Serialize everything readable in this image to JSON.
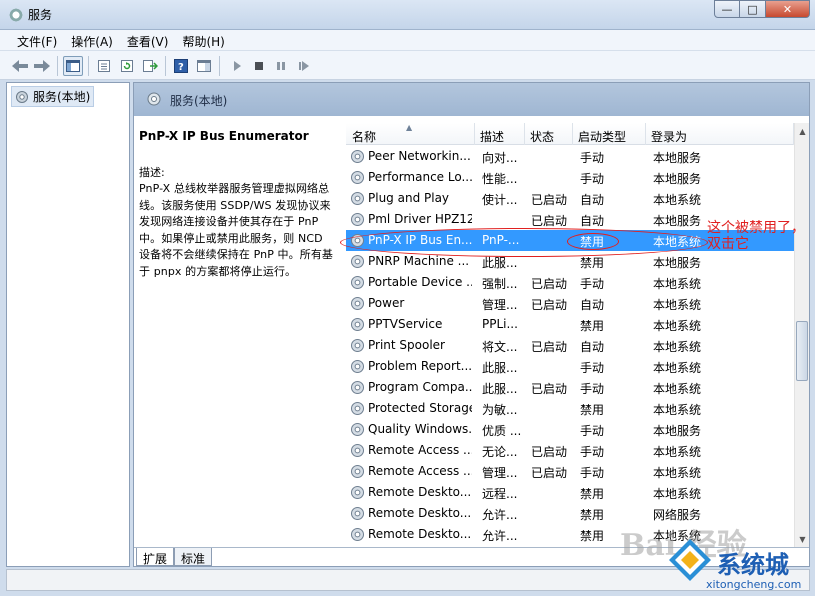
{
  "window": {
    "title": "服务",
    "controls": {
      "minimize": "—",
      "maximize": "□",
      "close": "✕"
    }
  },
  "menubar": [
    {
      "label": "文件(F)"
    },
    {
      "label": "操作(A)"
    },
    {
      "label": "查看(V)"
    },
    {
      "label": "帮助(H)"
    }
  ],
  "tree": {
    "item": "服务(本地)"
  },
  "pane_header": "服务(本地)",
  "description": {
    "title": "PnP-X IP Bus Enumerator",
    "label": "描述:",
    "body": "PnP-X 总线枚举器服务管理虚拟网络总线。该服务使用 SSDP/WS 发现协议来发现网络连接设备并使其存在于 PnP 中。如果停止或禁用此服务，则 NCD 设备将不会继续保持在 PnP 中。所有基于 pnpx 的方案都将停止运行。"
  },
  "columns": {
    "name": "名称",
    "desc": "描述",
    "status": "状态",
    "startup": "启动类型",
    "logon": "登录为"
  },
  "services": [
    {
      "name": "Peer Networkin...",
      "desc": "向对...",
      "status": "",
      "startup": "手动",
      "logon": "本地服务"
    },
    {
      "name": "Performance Lo...",
      "desc": "性能...",
      "status": "",
      "startup": "手动",
      "logon": "本地服务"
    },
    {
      "name": "Plug and Play",
      "desc": "使计...",
      "status": "已启动",
      "startup": "自动",
      "logon": "本地系统"
    },
    {
      "name": "Pml Driver HPZ12",
      "desc": "",
      "status": "已启动",
      "startup": "自动",
      "logon": "本地服务"
    },
    {
      "name": "PnP-X IP Bus En...",
      "desc": "PnP-...",
      "status": "",
      "startup": "禁用",
      "logon": "本地系统",
      "selected": true
    },
    {
      "name": "PNRP Machine ...",
      "desc": "此服...",
      "status": "",
      "startup": "禁用",
      "logon": "本地服务"
    },
    {
      "name": "Portable Device ...",
      "desc": "强制...",
      "status": "已启动",
      "startup": "手动",
      "logon": "本地系统"
    },
    {
      "name": "Power",
      "desc": "管理...",
      "status": "已启动",
      "startup": "自动",
      "logon": "本地系统"
    },
    {
      "name": "PPTVService",
      "desc": "PPLi...",
      "status": "",
      "startup": "禁用",
      "logon": "本地系统"
    },
    {
      "name": "Print Spooler",
      "desc": "将文...",
      "status": "已启动",
      "startup": "自动",
      "logon": "本地系统"
    },
    {
      "name": "Problem Report...",
      "desc": "此服...",
      "status": "",
      "startup": "手动",
      "logon": "本地系统"
    },
    {
      "name": "Program Compa...",
      "desc": "此服...",
      "status": "已启动",
      "startup": "手动",
      "logon": "本地系统"
    },
    {
      "name": "Protected Storage",
      "desc": "为敏...",
      "status": "",
      "startup": "禁用",
      "logon": "本地系统"
    },
    {
      "name": "Quality Windows...",
      "desc": "优质 ...",
      "status": "",
      "startup": "手动",
      "logon": "本地服务"
    },
    {
      "name": "Remote Access ...",
      "desc": "无论...",
      "status": "已启动",
      "startup": "手动",
      "logon": "本地系统"
    },
    {
      "name": "Remote Access ...",
      "desc": "管理...",
      "status": "已启动",
      "startup": "手动",
      "logon": "本地系统"
    },
    {
      "name": "Remote Deskto...",
      "desc": "远程...",
      "status": "",
      "startup": "禁用",
      "logon": "本地系统"
    },
    {
      "name": "Remote Deskto...",
      "desc": "允许...",
      "status": "",
      "startup": "禁用",
      "logon": "网络服务"
    },
    {
      "name": "Remote Deskto...",
      "desc": "允许...",
      "status": "",
      "startup": "禁用",
      "logon": "本地系统"
    }
  ],
  "tabs": {
    "extended": "扩展",
    "standard": "标准"
  },
  "annotation": "这个被禁用了，双击它",
  "watermark": {
    "baidu": "Bai 经验",
    "brand": "系统城",
    "url": "xitongcheng.com"
  },
  "colors": {
    "selection": "#3399ff",
    "annotation": "#e02020",
    "brand": "#1e5fb4"
  }
}
